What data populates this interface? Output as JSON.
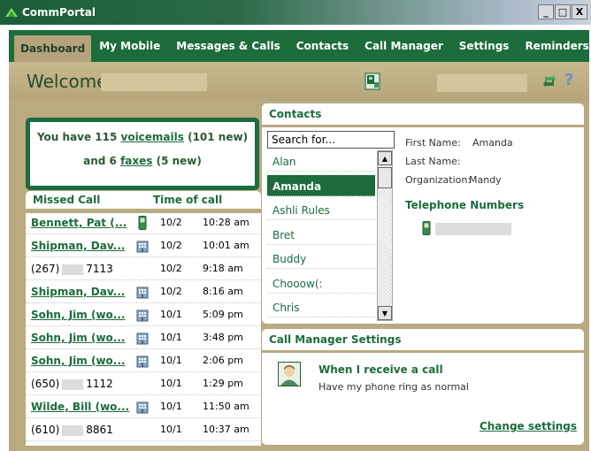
{
  "window": {
    "title": "CommPortal",
    "buttons": [
      "_",
      "□",
      "X"
    ]
  },
  "nav": {
    "tabs": [
      "Dashboard",
      "My Mobile",
      "Messages & Calls",
      "Contacts",
      "Call Manager",
      "Settings",
      "Reminders"
    ],
    "active": "Dashboard"
  },
  "welcome": {
    "text": "Welcome,"
  },
  "voicemail": {
    "line1_prefix": "You have 115 ",
    "voicemails_link": "voicemails",
    "line1_suffix": " (101 new)",
    "line2_prefix": "and  6 ",
    "faxes_link": "faxes",
    "line2_suffix": " (5 new)"
  },
  "missed_calls": {
    "header_missed": "Missed Call",
    "header_time": "Time of call",
    "rows": [
      {
        "name": "Bennett, Pat (...",
        "link": true,
        "icon": "mobile-phone-icon",
        "date": "10/2",
        "time": "10:28 am"
      },
      {
        "name": "Shipman, Dav...",
        "link": true,
        "icon": "office-building-icon",
        "date": "10/2",
        "time": "10:01 am"
      },
      {
        "name_prefix": "(267)",
        "name_suffix": "7113",
        "link": false,
        "date": "10/2",
        "time": "9:18 am"
      },
      {
        "name": "Shipman, Dav...",
        "link": true,
        "icon": "office-building-icon",
        "date": "10/2",
        "time": "8:16 am"
      },
      {
        "name": "Sohn, Jim (wo...",
        "link": true,
        "icon": "office-building-icon",
        "date": "10/1",
        "time": "5:09 pm"
      },
      {
        "name": "Sohn, Jim (wo...",
        "link": true,
        "icon": "office-building-icon",
        "date": "10/1",
        "time": "3:48 pm"
      },
      {
        "name": "Sohn, Jim (wo...",
        "link": true,
        "icon": "office-building-icon",
        "date": "10/1",
        "time": "2:06 pm"
      },
      {
        "name_prefix": "(650)",
        "name_suffix": "1112",
        "link": false,
        "date": "10/1",
        "time": "1:29 pm"
      },
      {
        "name": "Wilde, Bill (wo...",
        "link": true,
        "icon": "office-building-icon",
        "date": "10/1",
        "time": "11:50 am"
      },
      {
        "name_prefix": "(610)",
        "name_suffix": "8861",
        "link": false,
        "date": "10/1",
        "time": "10:37 am"
      }
    ]
  },
  "contacts": {
    "header": "Contacts",
    "search_value": "Search for...",
    "list": [
      "Alan",
      "Amanda",
      "Ashli Rules",
      "Bret",
      "Buddy",
      "Chooow(:",
      "Chris"
    ],
    "selected": "Amanda",
    "details": {
      "first_name_label": "First Name:",
      "first_name": "Amanda",
      "last_name_label": "Last Name:",
      "last_name": "",
      "organization_label": "Organization:",
      "organization": "Mandy"
    },
    "telephone_title": "Telephone Numbers"
  },
  "call_manager": {
    "header": "Call Manager Settings",
    "title": "When I receive a call",
    "text": "Have my phone ring as normal",
    "link": "Change settings"
  },
  "colors": {
    "brand_green": "#1c6c3c",
    "tan": "#b9aa80"
  }
}
